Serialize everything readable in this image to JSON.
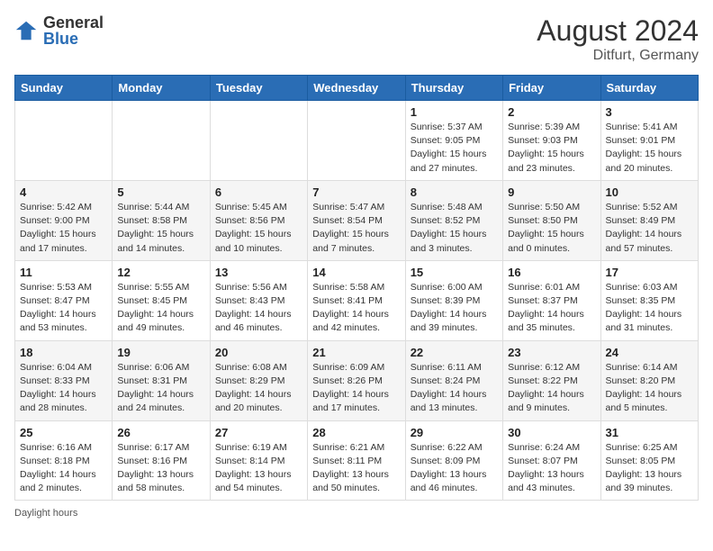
{
  "header": {
    "logo_general": "General",
    "logo_blue": "Blue",
    "month_year": "August 2024",
    "location": "Ditfurt, Germany"
  },
  "footer": {
    "note": "Daylight hours"
  },
  "days_of_week": [
    "Sunday",
    "Monday",
    "Tuesday",
    "Wednesday",
    "Thursday",
    "Friday",
    "Saturday"
  ],
  "weeks": [
    [
      {
        "day": "",
        "info": ""
      },
      {
        "day": "",
        "info": ""
      },
      {
        "day": "",
        "info": ""
      },
      {
        "day": "",
        "info": ""
      },
      {
        "day": "1",
        "info": "Sunrise: 5:37 AM\nSunset: 9:05 PM\nDaylight: 15 hours and 27 minutes."
      },
      {
        "day": "2",
        "info": "Sunrise: 5:39 AM\nSunset: 9:03 PM\nDaylight: 15 hours and 23 minutes."
      },
      {
        "day": "3",
        "info": "Sunrise: 5:41 AM\nSunset: 9:01 PM\nDaylight: 15 hours and 20 minutes."
      }
    ],
    [
      {
        "day": "4",
        "info": "Sunrise: 5:42 AM\nSunset: 9:00 PM\nDaylight: 15 hours and 17 minutes."
      },
      {
        "day": "5",
        "info": "Sunrise: 5:44 AM\nSunset: 8:58 PM\nDaylight: 15 hours and 14 minutes."
      },
      {
        "day": "6",
        "info": "Sunrise: 5:45 AM\nSunset: 8:56 PM\nDaylight: 15 hours and 10 minutes."
      },
      {
        "day": "7",
        "info": "Sunrise: 5:47 AM\nSunset: 8:54 PM\nDaylight: 15 hours and 7 minutes."
      },
      {
        "day": "8",
        "info": "Sunrise: 5:48 AM\nSunset: 8:52 PM\nDaylight: 15 hours and 3 minutes."
      },
      {
        "day": "9",
        "info": "Sunrise: 5:50 AM\nSunset: 8:50 PM\nDaylight: 15 hours and 0 minutes."
      },
      {
        "day": "10",
        "info": "Sunrise: 5:52 AM\nSunset: 8:49 PM\nDaylight: 14 hours and 57 minutes."
      }
    ],
    [
      {
        "day": "11",
        "info": "Sunrise: 5:53 AM\nSunset: 8:47 PM\nDaylight: 14 hours and 53 minutes."
      },
      {
        "day": "12",
        "info": "Sunrise: 5:55 AM\nSunset: 8:45 PM\nDaylight: 14 hours and 49 minutes."
      },
      {
        "day": "13",
        "info": "Sunrise: 5:56 AM\nSunset: 8:43 PM\nDaylight: 14 hours and 46 minutes."
      },
      {
        "day": "14",
        "info": "Sunrise: 5:58 AM\nSunset: 8:41 PM\nDaylight: 14 hours and 42 minutes."
      },
      {
        "day": "15",
        "info": "Sunrise: 6:00 AM\nSunset: 8:39 PM\nDaylight: 14 hours and 39 minutes."
      },
      {
        "day": "16",
        "info": "Sunrise: 6:01 AM\nSunset: 8:37 PM\nDaylight: 14 hours and 35 minutes."
      },
      {
        "day": "17",
        "info": "Sunrise: 6:03 AM\nSunset: 8:35 PM\nDaylight: 14 hours and 31 minutes."
      }
    ],
    [
      {
        "day": "18",
        "info": "Sunrise: 6:04 AM\nSunset: 8:33 PM\nDaylight: 14 hours and 28 minutes."
      },
      {
        "day": "19",
        "info": "Sunrise: 6:06 AM\nSunset: 8:31 PM\nDaylight: 14 hours and 24 minutes."
      },
      {
        "day": "20",
        "info": "Sunrise: 6:08 AM\nSunset: 8:29 PM\nDaylight: 14 hours and 20 minutes."
      },
      {
        "day": "21",
        "info": "Sunrise: 6:09 AM\nSunset: 8:26 PM\nDaylight: 14 hours and 17 minutes."
      },
      {
        "day": "22",
        "info": "Sunrise: 6:11 AM\nSunset: 8:24 PM\nDaylight: 14 hours and 13 minutes."
      },
      {
        "day": "23",
        "info": "Sunrise: 6:12 AM\nSunset: 8:22 PM\nDaylight: 14 hours and 9 minutes."
      },
      {
        "day": "24",
        "info": "Sunrise: 6:14 AM\nSunset: 8:20 PM\nDaylight: 14 hours and 5 minutes."
      }
    ],
    [
      {
        "day": "25",
        "info": "Sunrise: 6:16 AM\nSunset: 8:18 PM\nDaylight: 14 hours and 2 minutes."
      },
      {
        "day": "26",
        "info": "Sunrise: 6:17 AM\nSunset: 8:16 PM\nDaylight: 13 hours and 58 minutes."
      },
      {
        "day": "27",
        "info": "Sunrise: 6:19 AM\nSunset: 8:14 PM\nDaylight: 13 hours and 54 minutes."
      },
      {
        "day": "28",
        "info": "Sunrise: 6:21 AM\nSunset: 8:11 PM\nDaylight: 13 hours and 50 minutes."
      },
      {
        "day": "29",
        "info": "Sunrise: 6:22 AM\nSunset: 8:09 PM\nDaylight: 13 hours and 46 minutes."
      },
      {
        "day": "30",
        "info": "Sunrise: 6:24 AM\nSunset: 8:07 PM\nDaylight: 13 hours and 43 minutes."
      },
      {
        "day": "31",
        "info": "Sunrise: 6:25 AM\nSunset: 8:05 PM\nDaylight: 13 hours and 39 minutes."
      }
    ]
  ]
}
